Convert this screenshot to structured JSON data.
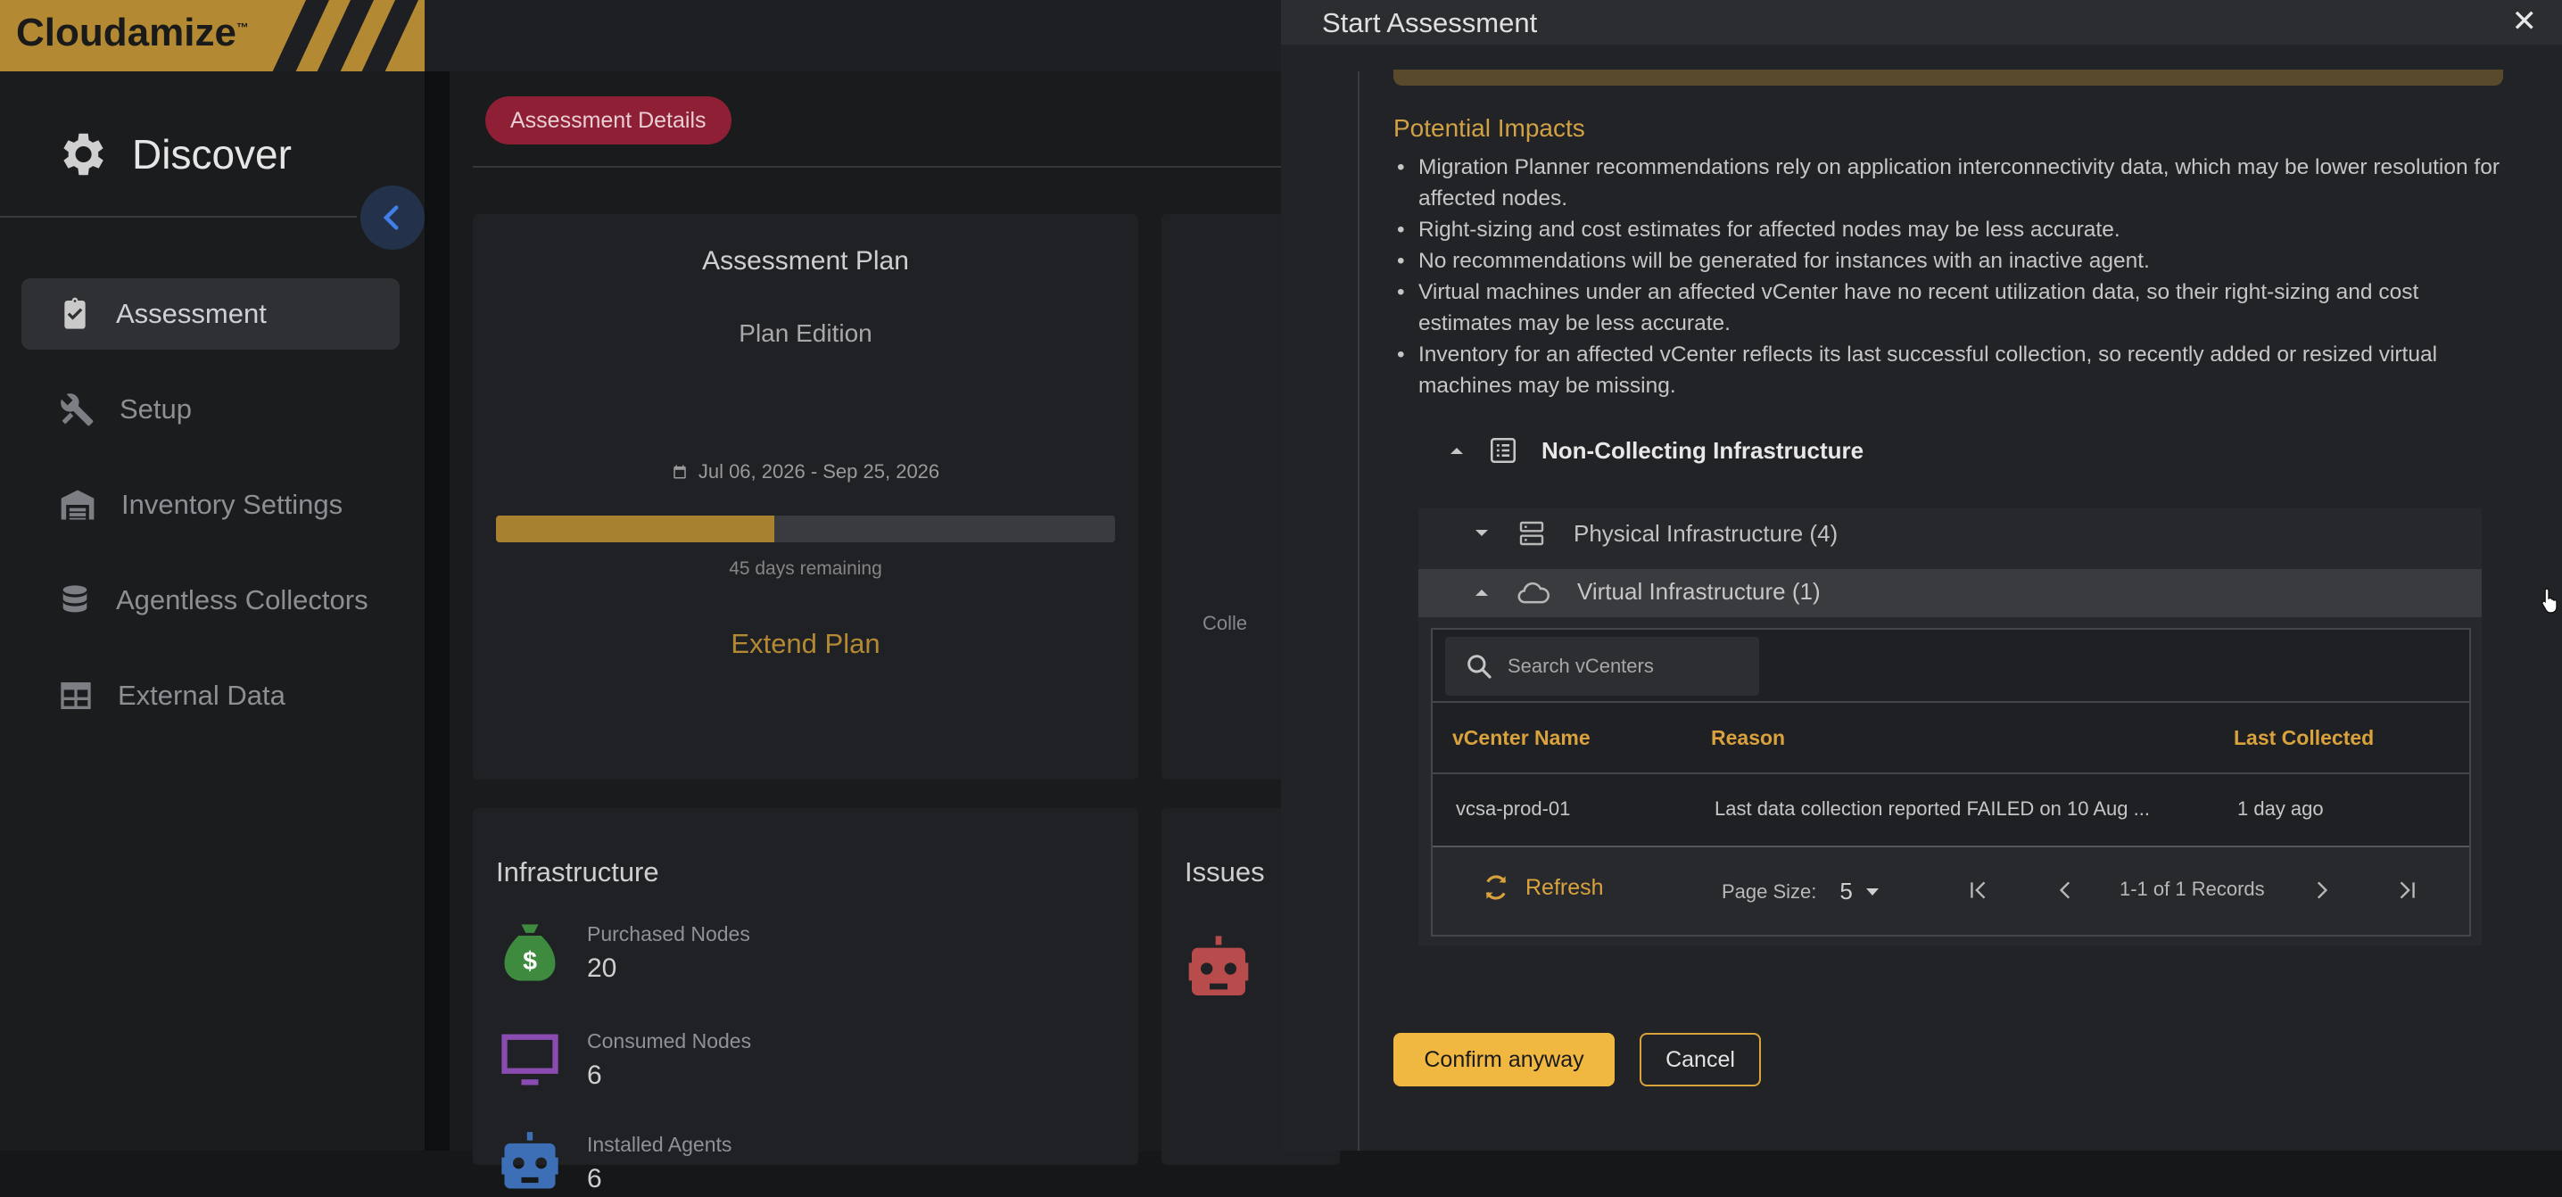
{
  "app": {
    "logo": "Cloudamize",
    "logo_mark": "™"
  },
  "sidebar": {
    "title": "Discover",
    "items": [
      {
        "label": "Assessment",
        "active": true
      },
      {
        "label": "Setup"
      },
      {
        "label": "Inventory Settings"
      },
      {
        "label": "Agentless Collectors"
      },
      {
        "label": "External Data"
      }
    ]
  },
  "main": {
    "tab": "Assessment Details",
    "plan": {
      "title": "Assessment Plan",
      "edition": "Plan Edition",
      "dates": "Jul 06, 2026 - Sep 25, 2026",
      "progress_fraction": 0.45,
      "remaining": "45 days remaining",
      "extend": "Extend Plan"
    },
    "right_card_fragment": "Colle",
    "infrastructure": {
      "title": "Infrastructure",
      "metrics": [
        {
          "label": "Purchased Nodes",
          "value": "20",
          "icon": "money-bag-icon",
          "color": "#3e8a3e"
        },
        {
          "label": "Consumed Nodes",
          "value": "6",
          "icon": "monitor-icon",
          "color": "#8a4cb0"
        },
        {
          "label": "Installed Agents",
          "value": "6",
          "icon": "robot-icon",
          "color": "#3c6fb5"
        }
      ]
    },
    "issues": {
      "title": "Issues"
    }
  },
  "modal": {
    "title": "Start Assessment",
    "impacts_title": "Potential Impacts",
    "impacts": [
      "Migration Planner recommendations rely on application interconnectivity data, which may be lower resolution for affected nodes.",
      "Right-sizing and cost estimates for affected nodes may be less accurate.",
      "No recommendations will be generated for instances with an inactive agent.",
      "Virtual machines under an affected vCenter have no recent utilization data, so their right-sizing and cost estimates may be less accurate.",
      "Inventory for an affected vCenter reflects its last successful collection, so recently added or resized virtual machines may be missing."
    ],
    "tree": {
      "root": "Non-Collecting Infrastructure",
      "physical": "Physical Infrastructure (4)",
      "virtual": "Virtual Infrastructure (1)"
    },
    "table": {
      "search_placeholder": "Search vCenters",
      "columns": [
        "vCenter Name",
        "Reason",
        "Last Collected"
      ],
      "rows": [
        [
          "vcsa-prod-01",
          "Last data collection reported FAILED on 10 Aug ...",
          "1 day ago"
        ]
      ],
      "refresh": "Refresh",
      "page_size_label": "Page Size:",
      "page_size": "5",
      "records": "1-1 of 1 Records"
    },
    "confirm": "Confirm anyway",
    "cancel": "Cancel"
  },
  "colors": {
    "accent": "#d9a23d",
    "brand": "#b38a33",
    "pill": "#8e1f35",
    "confirm": "#f0b840"
  }
}
